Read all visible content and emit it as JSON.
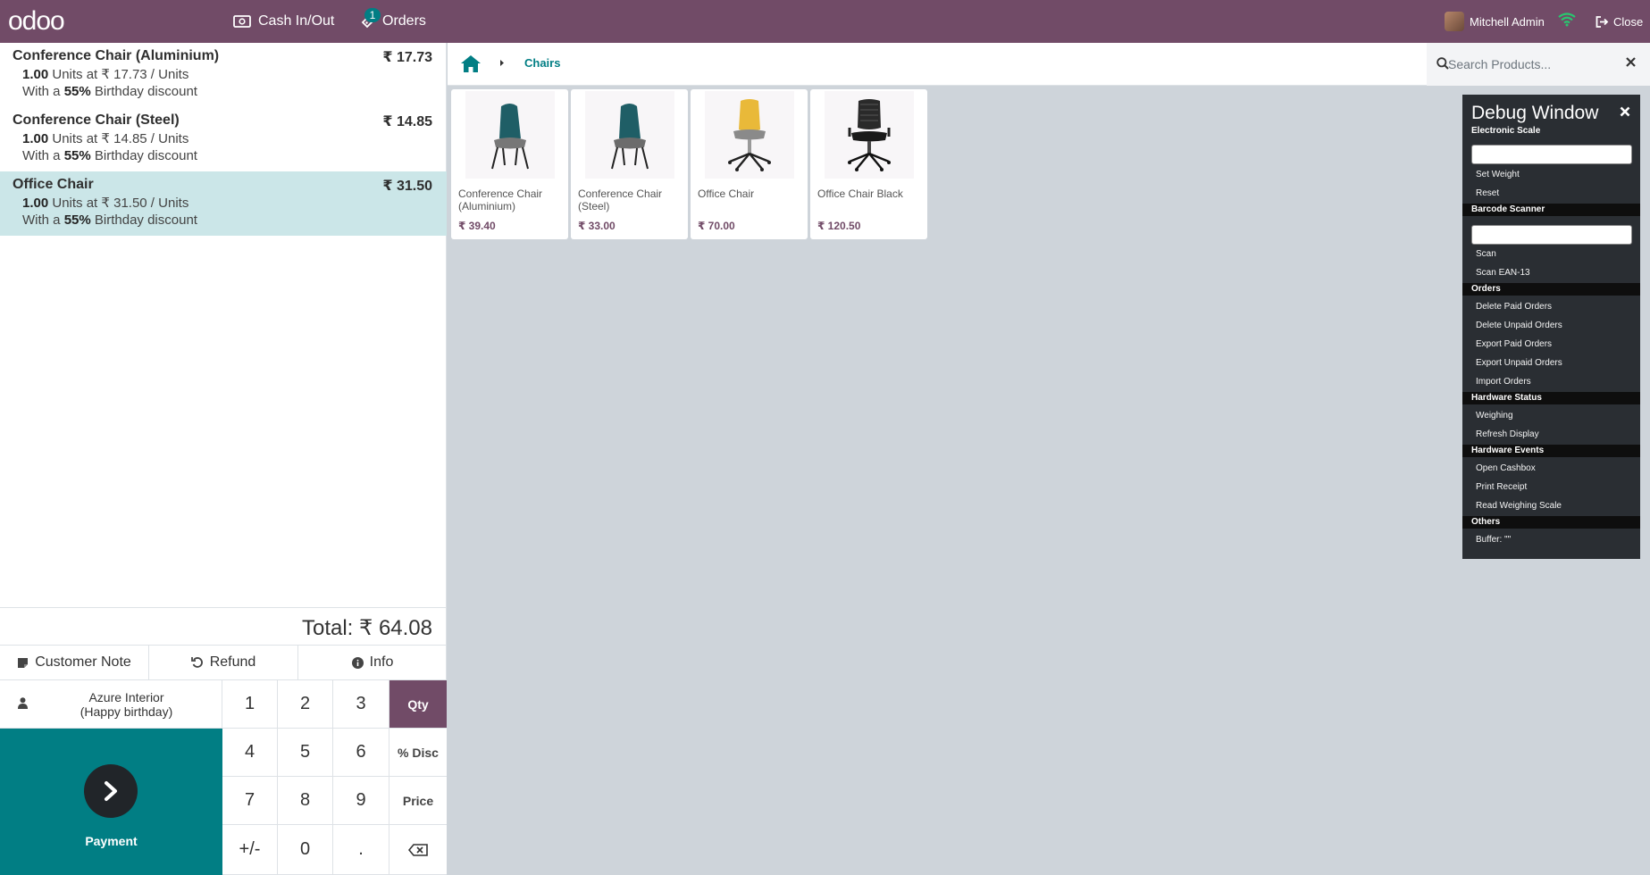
{
  "topbar": {
    "logo_text": "odoo",
    "cash_label": "Cash In/Out",
    "orders_label": "Orders",
    "orders_count": "1",
    "user_name": "Mitchell Admin",
    "close_label": "Close"
  },
  "order": {
    "lines": [
      {
        "name": "Conference Chair (Aluminium)",
        "price": "₹ 17.73",
        "qty": "1.00",
        "qty_info": " Units at ₹ 17.73 / Units",
        "disc_pre": "With a ",
        "disc": "55%",
        "disc_post": " Birthday discount"
      },
      {
        "name": "Conference Chair (Steel)",
        "price": "₹ 14.85",
        "qty": "1.00",
        "qty_info": " Units at ₹ 14.85 / Units",
        "disc_pre": "With a ",
        "disc": "55%",
        "disc_post": " Birthday discount"
      },
      {
        "name": "Office Chair",
        "price": "₹ 31.50",
        "qty": "1.00",
        "qty_info": " Units at ₹ 31.50 / Units",
        "disc_pre": "With a ",
        "disc": "55%",
        "disc_post": " Birthday discount"
      }
    ],
    "total_label": "Total: ₹ 64.08"
  },
  "actions": {
    "customer_note": "Customer Note",
    "refund": "Refund",
    "info": "Info"
  },
  "customer": {
    "line1": "Azure Interior",
    "line2": "(Happy birthday)"
  },
  "payment_label": "Payment",
  "numpad": {
    "k1": "1",
    "k2": "2",
    "k3": "3",
    "qty": "Qty",
    "k4": "4",
    "k5": "5",
    "k6": "6",
    "disc": "% Disc",
    "k7": "7",
    "k8": "8",
    "k9": "9",
    "price": "Price",
    "sign": "+/-",
    "k0": "0",
    "dot": ".",
    "active_mode": "Qty"
  },
  "breadcrumb": {
    "category": "Chairs"
  },
  "search": {
    "placeholder": "Search Products..."
  },
  "products": [
    {
      "name": "Conference Chair (Aluminium)",
      "price": "₹ 39.40",
      "icon": "teal-chair"
    },
    {
      "name": "Conference Chair (Steel)",
      "price": "₹ 33.00",
      "icon": "teal-chair"
    },
    {
      "name": "Office Chair",
      "price": "₹ 70.00",
      "icon": "yellow-office-chair"
    },
    {
      "name": "Office Chair Black",
      "price": "₹ 120.50",
      "icon": "black-office-chair"
    }
  ],
  "debug": {
    "title": "Debug Window",
    "electronic_scale": "Electronic Scale",
    "set_weight": "Set Weight",
    "reset": "Reset",
    "barcode_scanner": "Barcode Scanner",
    "scan": "Scan",
    "scan_ean": "Scan EAN-13",
    "orders": "Orders",
    "delete_paid": "Delete Paid Orders",
    "delete_unpaid": "Delete Unpaid Orders",
    "export_paid": "Export Paid Orders",
    "export_unpaid": "Export Unpaid Orders",
    "import_orders": "Import Orders",
    "hardware_status": "Hardware Status",
    "weighing": "Weighing",
    "refresh_display": "Refresh Display",
    "hardware_events": "Hardware Events",
    "open_cashbox": "Open Cashbox",
    "print_receipt": "Print Receipt",
    "read_scale": "Read Weighing Scale",
    "others": "Others",
    "buffer": "Buffer: \"\""
  },
  "colors": {
    "brand": "#714b67",
    "accent": "#017e84",
    "selected_line": "#cbe6e8"
  }
}
